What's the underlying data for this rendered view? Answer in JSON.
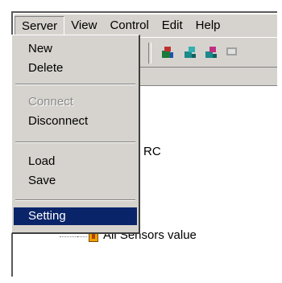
{
  "menubar": {
    "items": [
      "Server",
      "View",
      "Control",
      "Edit",
      "Help"
    ]
  },
  "server_menu": {
    "items": [
      {
        "label": "New",
        "enabled": true
      },
      {
        "label": "Delete",
        "enabled": true
      },
      {
        "label": "Connect",
        "enabled": false
      },
      {
        "label": "Disconnect",
        "enabled": true
      },
      {
        "label": "Load",
        "enabled": true
      },
      {
        "label": "Save",
        "enabled": true
      },
      {
        "label": "Setting",
        "enabled": true,
        "selected": true
      }
    ]
  },
  "tree": {
    "partial_label": "RC",
    "sensors_label": "All Sensors value"
  },
  "colors": {
    "menu_bg": "#d6d3ce",
    "selection": "#0a246a",
    "sensor_icon": "#f0a000"
  },
  "icons": [
    "toolbar-button-icon",
    "sensor-node-icon"
  ]
}
